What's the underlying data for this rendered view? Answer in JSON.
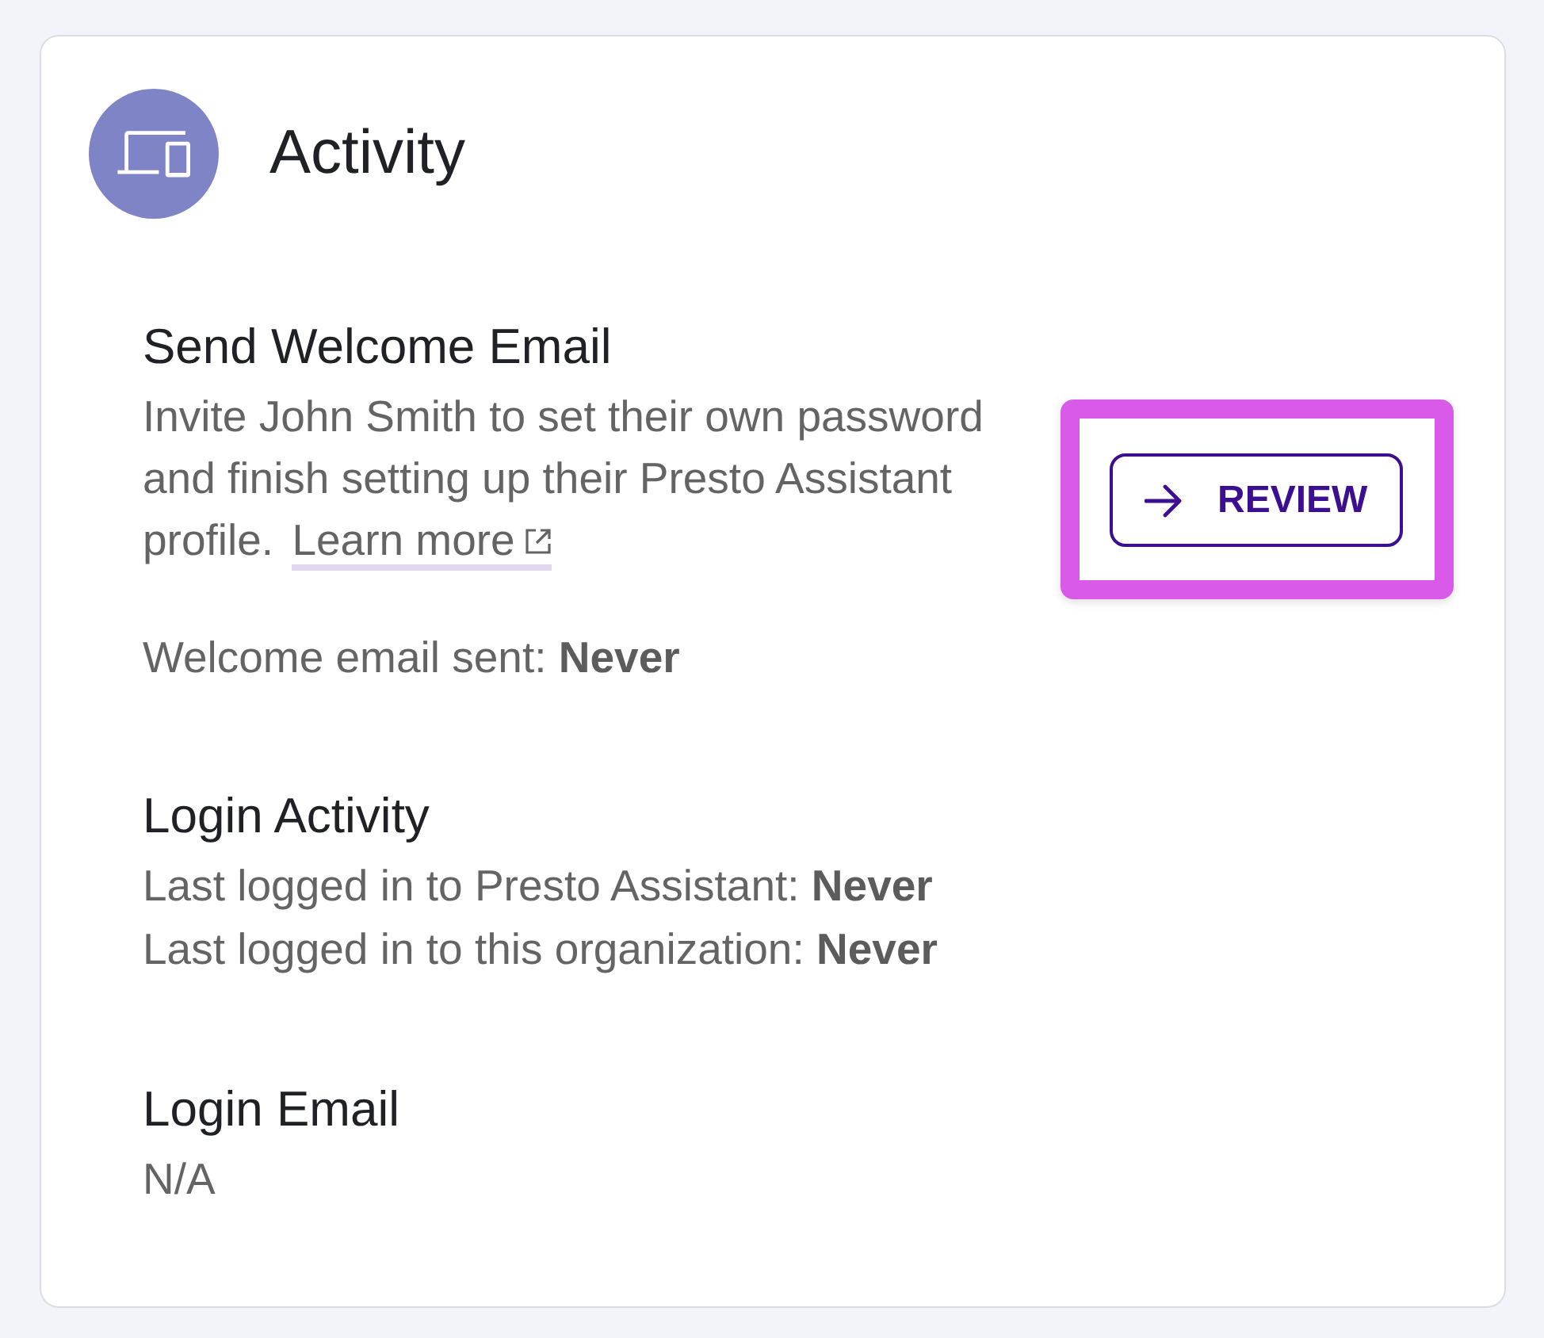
{
  "header": {
    "title": "Activity"
  },
  "sections": [
    {
      "kind": "action",
      "title": "Send Welcome Email",
      "description": "Invite John Smith to set their own password and finish setting up their Presto Assistant profile.",
      "link": "Learn more",
      "status": "Welcome email sent: **Never**",
      "button": {
        "label": "REVIEW",
        "highlighted": true
      }
    },
    {
      "kind": "info",
      "title": "Login Activity",
      "lines": [
        "Last logged in to Presto Assistant: **Never**",
        "Last logged in to this organization: **Never**"
      ]
    },
    {
      "kind": "info",
      "title": "Login Email",
      "lines": [
        "N/A"
      ]
    }
  ]
}
